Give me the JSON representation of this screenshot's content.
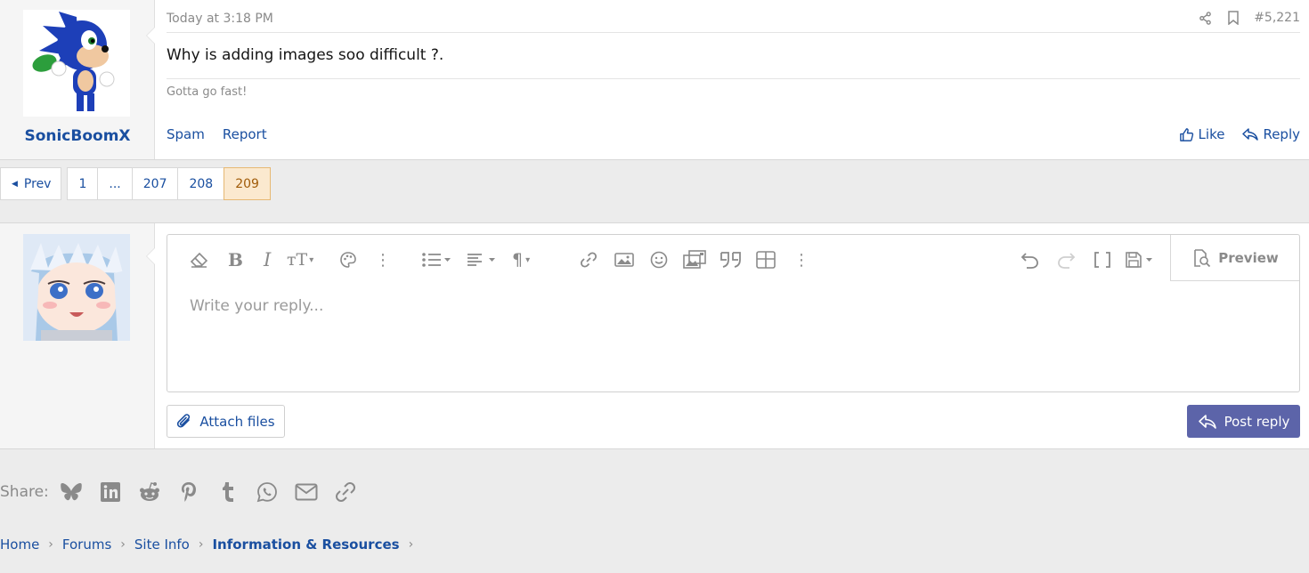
{
  "post": {
    "username": "SonicBoomX",
    "date": "Today at 3:18 PM",
    "post_number": "#5,221",
    "body": "Why is adding images soo difficult ?.",
    "signature": "Gotta go fast!",
    "actions_left": [
      "Spam",
      "Report"
    ],
    "like_label": "Like",
    "reply_label": "Reply"
  },
  "pagination": {
    "prev_label": "Prev",
    "pages": [
      "1",
      "...",
      "207",
      "208",
      "209"
    ],
    "current": "209"
  },
  "editor": {
    "placeholder": "Write your reply...",
    "preview_label": "Preview",
    "attach_label": "Attach files",
    "post_reply_label": "Post reply"
  },
  "share": {
    "label": "Share:",
    "icons": [
      "bluesky-icon",
      "linkedin-icon",
      "reddit-icon",
      "pinterest-icon",
      "tumblr-icon",
      "whatsapp-icon",
      "email-icon",
      "link-icon"
    ]
  },
  "breadcrumb": {
    "items": [
      "Home",
      "Forums",
      "Site Info",
      "Information & Resources"
    ]
  },
  "colors": {
    "link": "#1a4fa0",
    "accent_button": "#5c64a9",
    "current_page_bg": "#fbe9cf"
  }
}
